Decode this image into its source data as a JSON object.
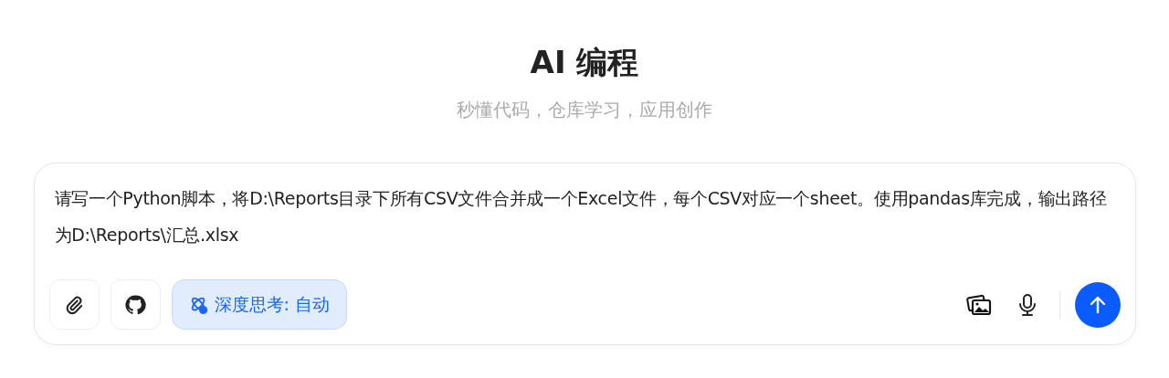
{
  "header": {
    "title": "AI 编程",
    "subtitle": "秒懂代码，仓库学习，应用创作"
  },
  "composer": {
    "value": "请写一个Python脚本，将D:\\Reports目录下所有CSV文件合并成一个Excel文件，每个CSV对应一个sheet。使用pandas库完成，输出路径为D:\\Reports\\汇总.xlsx",
    "deep_thinking": {
      "label": "深度思考: 自动",
      "selected": true
    }
  }
}
